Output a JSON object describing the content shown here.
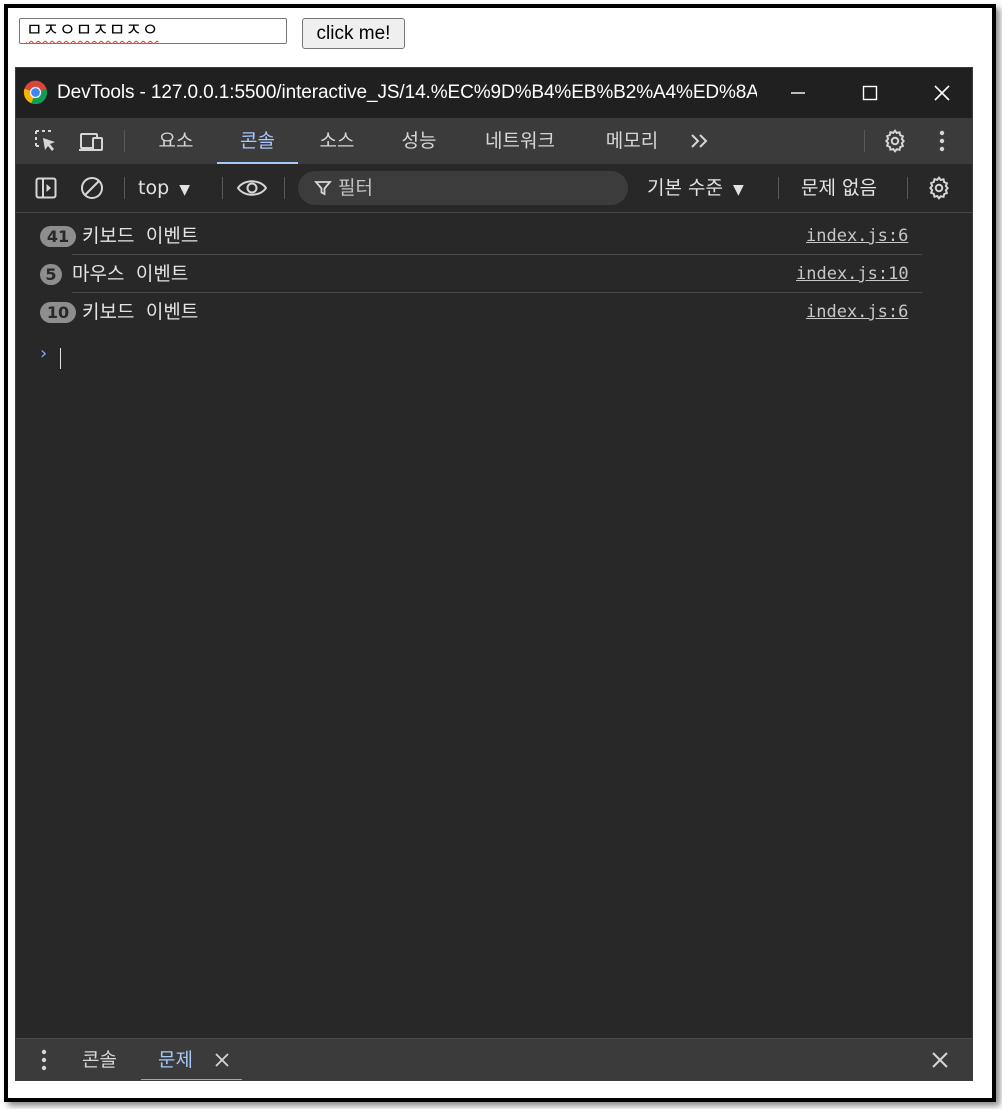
{
  "page": {
    "input_value": "ㅁㅈㅇㅁㅈㅁㅈㅇ",
    "button_label": "click me!"
  },
  "devtools": {
    "title": "DevTools - 127.0.0.1:5500/interactive_JS/14.%EC%9D%B4%EB%B2%A4%ED%8A...",
    "tabs": [
      {
        "label": "요소",
        "active": false
      },
      {
        "label": "콘솔",
        "active": true
      },
      {
        "label": "소스",
        "active": false
      },
      {
        "label": "성능",
        "active": false
      },
      {
        "label": "네트워크",
        "active": false
      },
      {
        "label": "메모리",
        "active": false
      }
    ],
    "toolbar": {
      "context": "top",
      "filter_placeholder": "필터",
      "level": "기본 수준",
      "issues": "문제 없음"
    },
    "logs": [
      {
        "count": "41",
        "message": "키보드 이벤트",
        "source": "index.js:6"
      },
      {
        "count": "5",
        "message": "마우스 이벤트",
        "source": "index.js:10"
      },
      {
        "count": "10",
        "message": "키보드 이벤트",
        "source": "index.js:6"
      }
    ],
    "prompt": "›",
    "drawer": {
      "tabs": [
        {
          "label": "콘솔",
          "active": false
        },
        {
          "label": "문제",
          "active": true
        }
      ]
    }
  },
  "colors": {
    "accent": "#a8c7fa",
    "panel_bg": "#282828",
    "tabbar_bg": "#3b3b3b",
    "titlebar_bg": "#202020"
  }
}
